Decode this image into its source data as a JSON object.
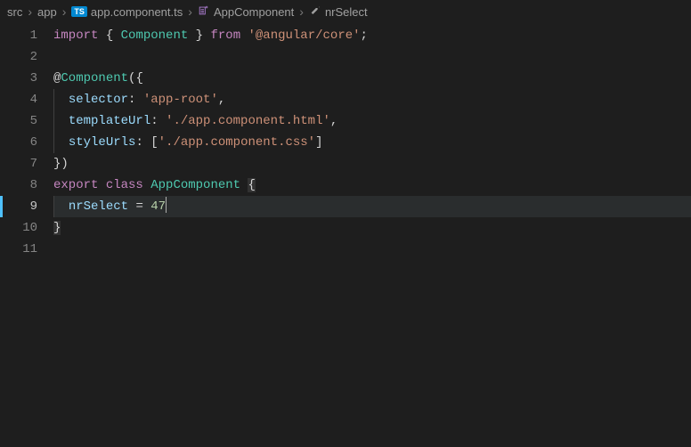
{
  "breadcrumb": {
    "items": [
      {
        "label": "src",
        "icon": null
      },
      {
        "label": "app",
        "icon": null
      },
      {
        "label": "app.component.ts",
        "icon": "ts-file"
      },
      {
        "label": "AppComponent",
        "icon": "symbol-class"
      },
      {
        "label": "nrSelect",
        "icon": "symbol-property"
      }
    ]
  },
  "editor": {
    "active_line": 9,
    "lines": {
      "l1": {
        "kw_import": "import",
        "brace_o": "{",
        "sym": "Component",
        "brace_c": "}",
        "kw_from": "from",
        "str": "'@angular/core'",
        "semi": ";"
      },
      "l3": {
        "at": "@",
        "deco": "Component",
        "paren_o": "(",
        "brace_o": "{"
      },
      "l4": {
        "prop": "selector",
        "colon": ":",
        "str": "'app-root'",
        "comma": ","
      },
      "l5": {
        "prop": "templateUrl",
        "colon": ":",
        "str": "'./app.component.html'",
        "comma": ","
      },
      "l6": {
        "prop": "styleUrls",
        "colon": ":",
        "brack_o": "[",
        "str": "'./app.component.css'",
        "brack_c": "]"
      },
      "l7": {
        "brace_c": "}",
        "paren_c": ")"
      },
      "l8": {
        "kw_export": "export",
        "kw_class": "class",
        "sym": "AppComponent",
        "brace_o": "{"
      },
      "l9": {
        "var": "nrSelect",
        "eq": "=",
        "num": "47"
      },
      "l10": {
        "brace_c": "}"
      }
    },
    "line_count": 11
  }
}
